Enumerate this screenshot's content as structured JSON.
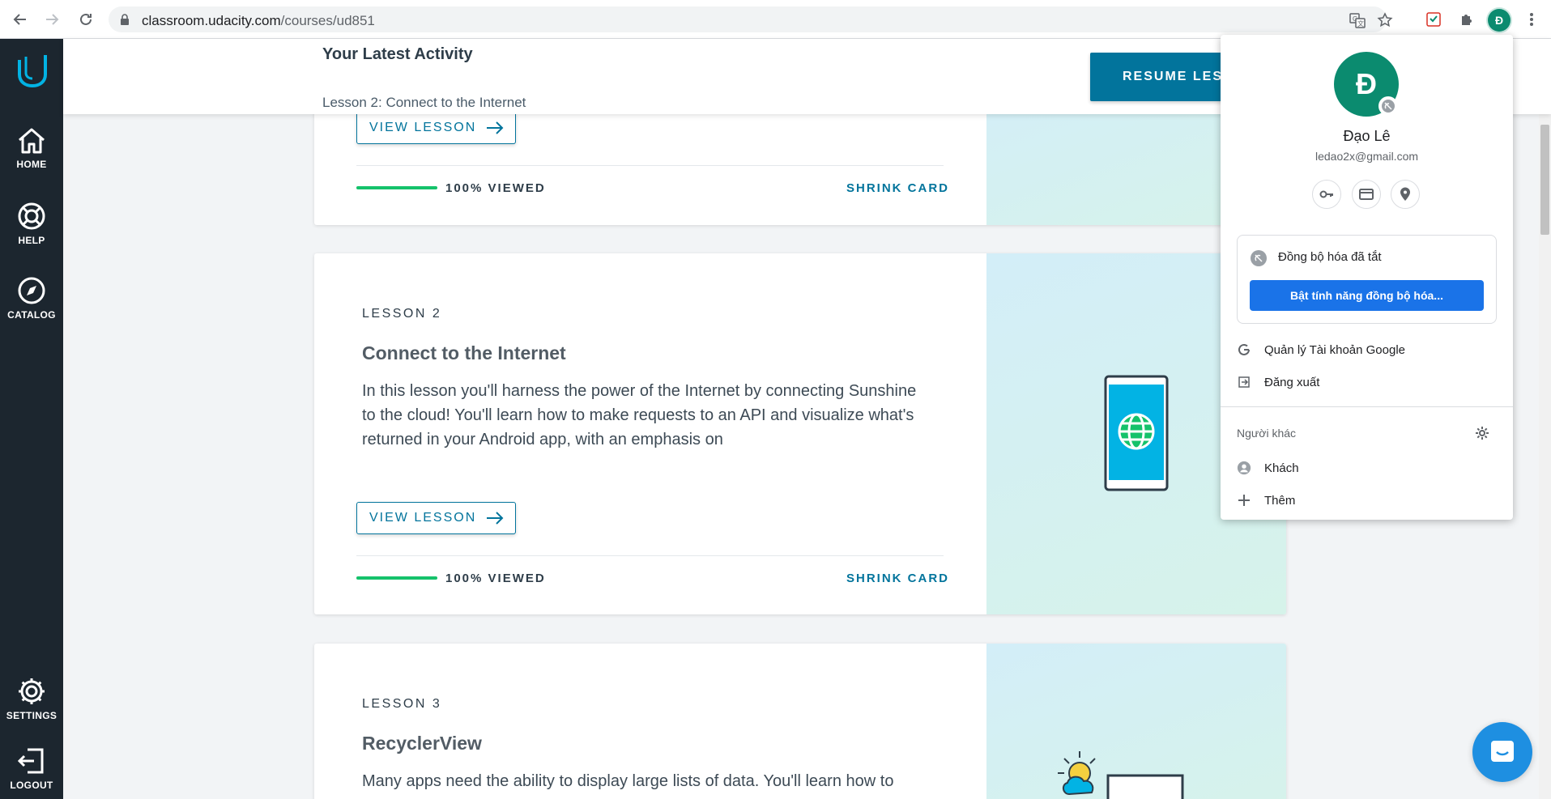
{
  "browser": {
    "url_host": "classroom.udacity.com",
    "url_path": "/courses/ud851",
    "profile_initial": "Đ"
  },
  "sidebar": {
    "items": [
      {
        "label": "HOME",
        "icon": "home-icon"
      },
      {
        "label": "HELP",
        "icon": "lifebuoy-icon"
      },
      {
        "label": "CATALOG",
        "icon": "compass-icon"
      },
      {
        "label": "SETTINGS",
        "icon": "gear-icon"
      },
      {
        "label": "LOGOUT",
        "icon": "logout-icon"
      }
    ]
  },
  "activity": {
    "title": "Your Latest Activity",
    "subtitle": "Lesson 2: Connect to the Internet",
    "resume_label": "RESUME LESSON"
  },
  "cards": [
    {
      "view_label": "VIEW LESSON",
      "progress": 1.0,
      "viewed_label": "100% VIEWED",
      "shrink_label": "SHRINK CARD"
    },
    {
      "lesson_num": "LESSON 2",
      "title": "Connect to the Internet",
      "description": "In this lesson you'll harness the power of the Internet by connecting Sunshine to the cloud! You'll learn how to make requests to an API and visualize what's returned in your Android app, with an emphasis on",
      "view_label": "VIEW LESSON",
      "progress": 1.0,
      "viewed_label": "100% VIEWED",
      "shrink_label": "SHRINK CARD",
      "art": "phone-globe-icon"
    },
    {
      "lesson_num": "LESSON 3",
      "title": "RecyclerView",
      "description": "Many apps need the ability to display large lists of data. You'll learn how to",
      "art": "weather-cloud-icon"
    }
  ],
  "profile_popup": {
    "initial": "Đ",
    "name": "Đạo Lê",
    "email": "ledao2x@gmail.com",
    "sync_status": "Đồng bộ hóa đã tắt",
    "sync_button": "Bật tính năng đồng bộ hóa...",
    "manage_account": "Quản lý Tài khoản Google",
    "sign_out": "Đăng xuất",
    "others_title": "Người khác",
    "guest": "Khách",
    "add": "Thêm"
  },
  "colors": {
    "accent": "#02749c",
    "sidebar_bg": "#1c262f",
    "progress": "#15c26b",
    "avatar": "#0b8b6f",
    "chrome_blue": "#1a73e8"
  }
}
